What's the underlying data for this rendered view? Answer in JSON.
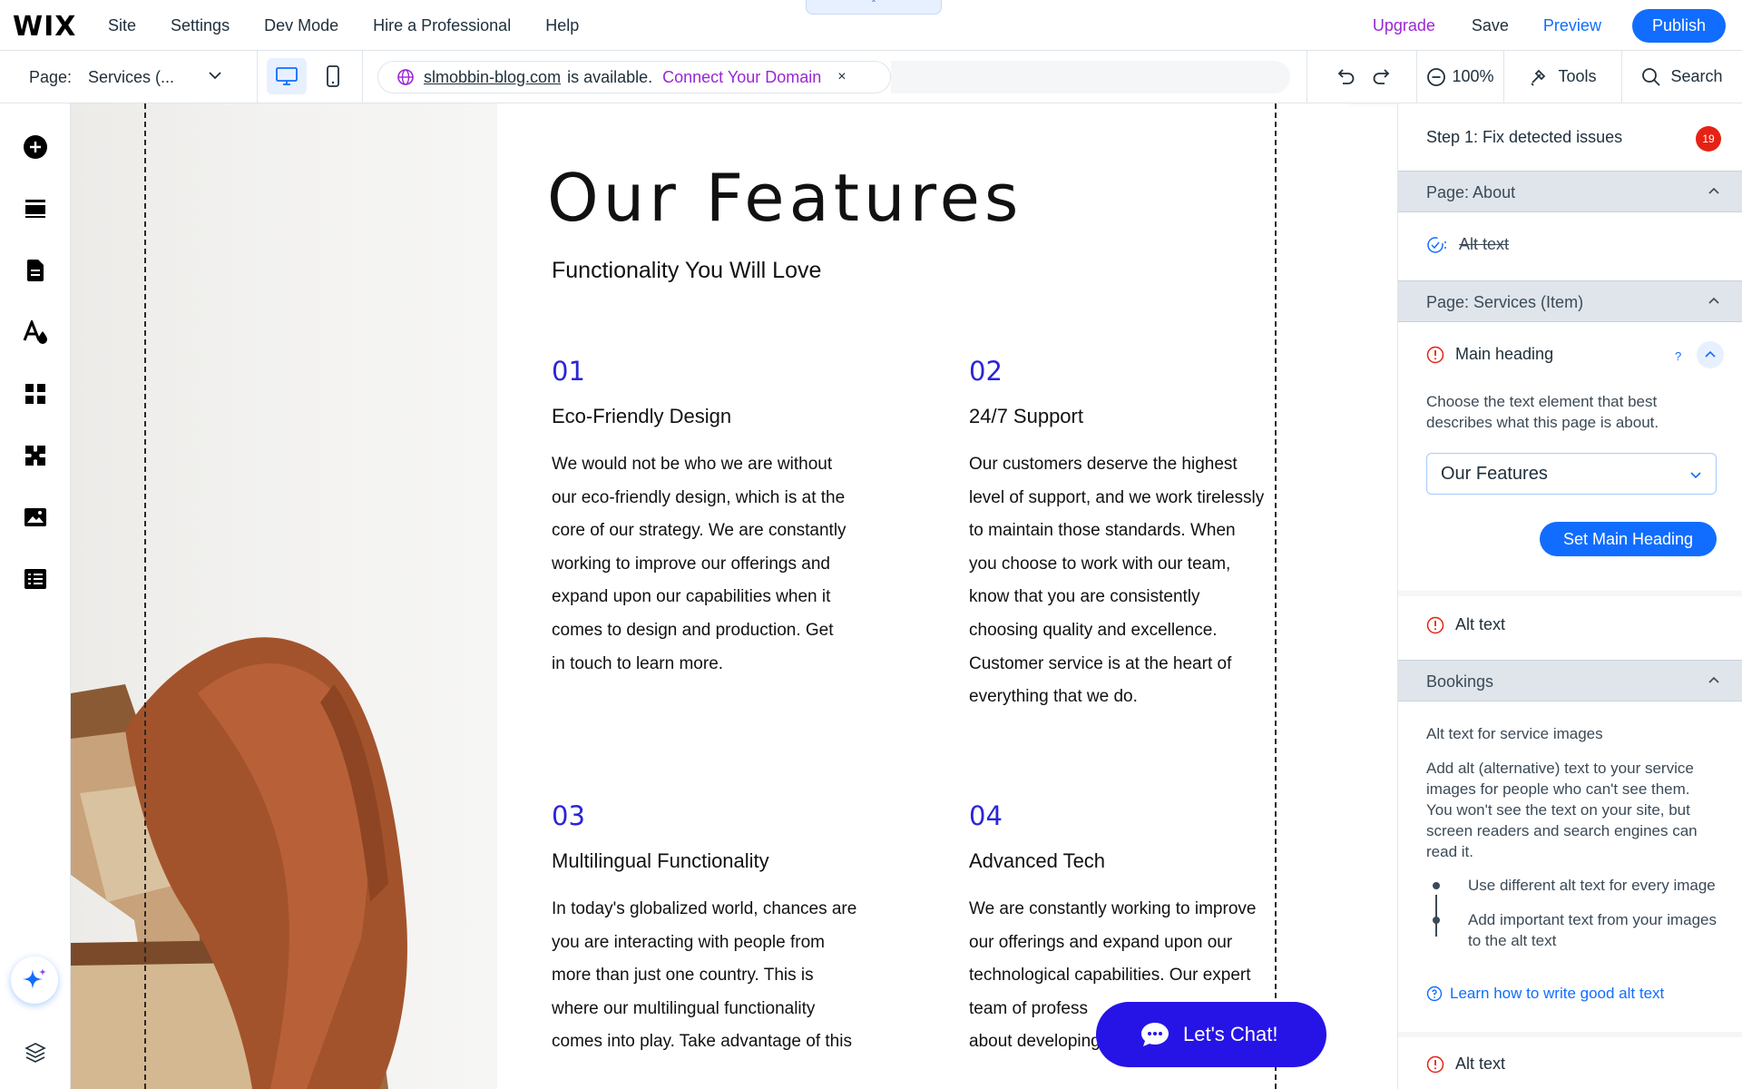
{
  "topbar": {
    "logo": "WIX",
    "nav": [
      "Site",
      "Settings",
      "Dev Mode",
      "Hire a Professional",
      "Help"
    ],
    "upgrade": "Upgrade",
    "save": "Save",
    "preview": "Preview",
    "publish": "Publish"
  },
  "subbar": {
    "page_label": "Page:",
    "page_value": "Services (...",
    "domain_name": "slmobbin-blog.com",
    "domain_available": "is available.",
    "connect_domain": "Connect Your Domain",
    "close_glyph": "×",
    "zoom": "100%",
    "tools": "Tools",
    "search": "Search"
  },
  "canvas": {
    "title": "Our Features",
    "subtitle": "Functionality You Will Love",
    "features": [
      {
        "num": "01",
        "title": "Eco-Friendly Design",
        "lines": [
          "We would not be who we are without",
          "our eco-friendly design, which is at the",
          "core of our strategy. We are constantly",
          "working to improve our offerings and",
          "expand upon our capabilities when it",
          "comes to design and production. Get",
          "in touch to learn more."
        ]
      },
      {
        "num": "02",
        "title": "24/7 Support",
        "lines": [
          "Our customers deserve the highest",
          "level of support, and we work tirelessly",
          "to maintain those standards. When",
          "you choose to work with our team,",
          "know that you are consistently",
          "choosing quality and excellence.",
          "Customer service is at the heart of",
          "everything that we do."
        ]
      },
      {
        "num": "03",
        "title": "Multilingual Functionality",
        "lines": [
          "In today's globalized world, chances are",
          "you are interacting with people from",
          "more than just one country. This is",
          "where our multilingual functionality",
          "comes into play. Take advantage of this"
        ]
      },
      {
        "num": "04",
        "title": "Advanced Tech",
        "lines": [
          "We are constantly working to improve",
          "our offerings and expand upon our",
          "technological capabilities. Our expert",
          "team of profess",
          "about developing"
        ]
      }
    ],
    "chat_label": "Let's Chat!"
  },
  "panel": {
    "heading": "Step 1: Fix detected issues",
    "badge": "19",
    "section_about": "Page: About",
    "about_item": "Alt text",
    "section_services": "Page: Services (Item)",
    "main_heading": "Main heading",
    "help_mark": "?",
    "main_heading_desc": "Choose the text element that best describes what this page is about.",
    "select_value": "Our Features",
    "set_button": "Set Main Heading",
    "alt_text_1": "Alt text",
    "section_bookings": "Bookings",
    "bookings_title": "Alt text for service images",
    "bookings_desc": "Add alt (alternative) text to your service images for people who can't see them. You won't see the text on your site, but screen readers and search engines can read it.",
    "bullet_1": "Use different alt text for every image",
    "bullet_2": "Add important text from your images to the alt text",
    "learn_link": "Learn how to write good alt text",
    "alt_text_2": "Alt text"
  },
  "colors": {
    "accent": "#116dff",
    "upgrade": "#9a27d5",
    "feature_number": "#2a25d9",
    "chat_button": "#2614e6",
    "badge": "#e62214",
    "error_icon": "#e62214"
  },
  "icons": {
    "left_toolbar": [
      "add-icon",
      "sections-icon",
      "pages-icon",
      "design-icon",
      "apps-icon",
      "extensions-icon",
      "media-icon",
      "cms-icon",
      "ai-assistant-icon",
      "layers-icon"
    ]
  }
}
